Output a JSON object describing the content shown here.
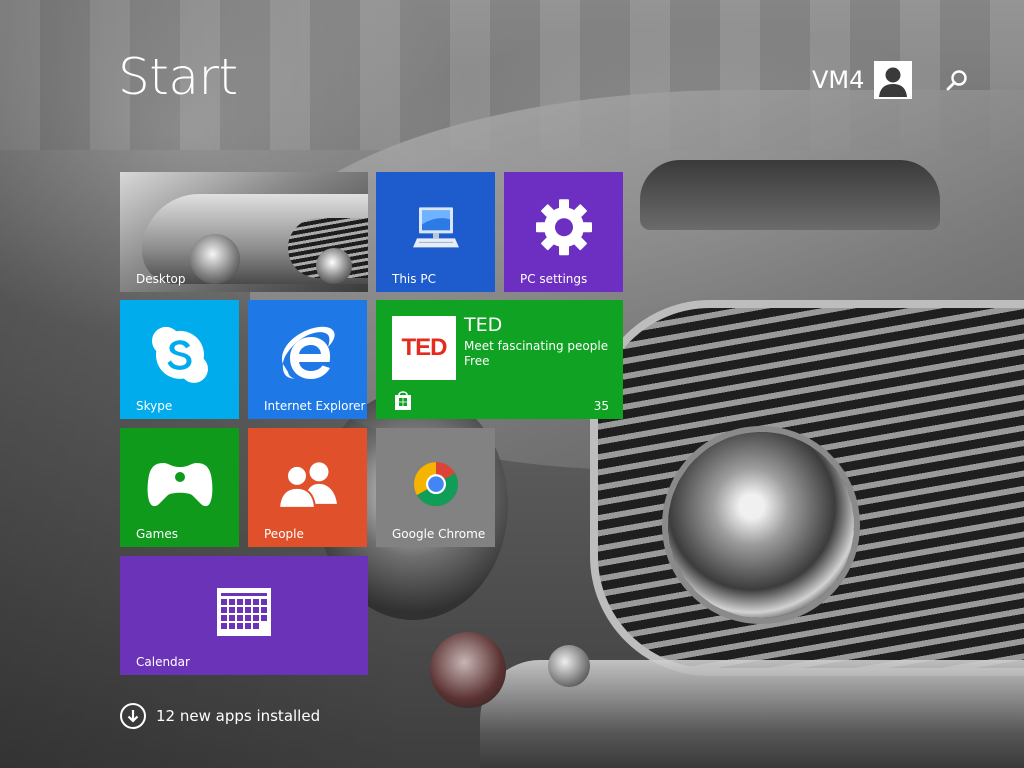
{
  "header": {
    "title": "Start",
    "user_name": "VM4",
    "avatar_icon": "user-avatar-icon",
    "search_icon": "search-icon"
  },
  "tiles": {
    "desktop": {
      "label": "Desktop"
    },
    "this_pc": {
      "label": "This PC",
      "icon": "computer-icon",
      "color": "#1e5bcc"
    },
    "pc_settings": {
      "label": "PC settings",
      "icon": "gear-icon",
      "color": "#6d2fc1"
    },
    "skype": {
      "label": "Skype",
      "icon": "skype-icon",
      "color": "#00acec"
    },
    "ie": {
      "label": "Internet Explorer",
      "icon": "internet-explorer-icon",
      "color": "#1e79e6"
    },
    "ted": {
      "logo_text": "TED",
      "title": "TED",
      "subtitle": "Meet fascinating people",
      "price": "Free",
      "count": "35",
      "store_icon": "store-icon",
      "color": "#10a323"
    },
    "games": {
      "label": "Games",
      "icon": "xbox-controller-icon",
      "color": "#0f9a1c"
    },
    "people": {
      "label": "People",
      "icon": "people-icon",
      "color": "#e0502a"
    },
    "chrome": {
      "label": "Google Chrome",
      "icon": "chrome-icon",
      "color": "#828282"
    },
    "calendar": {
      "label": "Calendar",
      "icon": "calendar-icon",
      "color": "#6b33b8"
    }
  },
  "footer": {
    "apps_installed": "12 new apps installed",
    "down_icon": "arrow-down-circle-icon"
  }
}
